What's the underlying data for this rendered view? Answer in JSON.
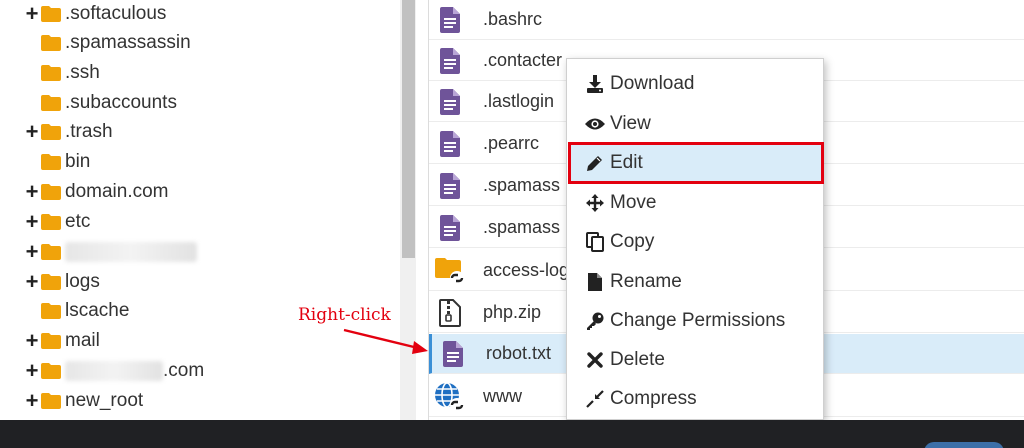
{
  "tree": {
    "items": [
      {
        "toggle": "+",
        "label": ".softaculous",
        "blurred": false
      },
      {
        "toggle": "",
        "label": ".spamassassin",
        "blurred": false
      },
      {
        "toggle": "",
        "label": ".ssh",
        "blurred": false
      },
      {
        "toggle": "",
        "label": ".subaccounts",
        "blurred": false
      },
      {
        "toggle": "+",
        "label": ".trash",
        "blurred": false
      },
      {
        "toggle": "",
        "label": "bin",
        "blurred": false
      },
      {
        "toggle": "+",
        "label": "domain.com",
        "blurred": false
      },
      {
        "toggle": "+",
        "label": "etc",
        "blurred": false
      },
      {
        "toggle": "+",
        "label": "",
        "blurred": true
      },
      {
        "toggle": "+",
        "label": "logs",
        "blurred": false
      },
      {
        "toggle": "",
        "label": "lscache",
        "blurred": false
      },
      {
        "toggle": "+",
        "label": "mail",
        "blurred": false
      },
      {
        "toggle": "+",
        "label": ".com",
        "blurred": true
      },
      {
        "toggle": "+",
        "label": "new_root",
        "blurred": false
      }
    ]
  },
  "files": {
    "items": [
      {
        "name": ".bashrc",
        "icon": "text-file-icon"
      },
      {
        "name": ".contacter",
        "icon": "text-file-icon"
      },
      {
        "name": ".lastlogin",
        "icon": "text-file-icon"
      },
      {
        "name": ".pearrc",
        "icon": "text-file-icon"
      },
      {
        "name": ".spamass",
        "icon": "text-file-icon"
      },
      {
        "name": ".spamass",
        "icon": "text-file-icon"
      },
      {
        "name": "access-log",
        "icon": "folder-link-icon"
      },
      {
        "name": "php.zip",
        "icon": "zip-file-icon"
      },
      {
        "name": "robot.txt",
        "icon": "text-file-icon",
        "selected": true
      },
      {
        "name": "www",
        "icon": "globe-link-icon"
      }
    ]
  },
  "context_menu": {
    "items": [
      {
        "label": "Download",
        "icon": "download-icon"
      },
      {
        "label": "View",
        "icon": "eye-icon"
      },
      {
        "label": "Edit",
        "icon": "pencil-icon",
        "highlighted": true
      },
      {
        "label": "Move",
        "icon": "move-arrows-icon"
      },
      {
        "label": "Copy",
        "icon": "copy-icon"
      },
      {
        "label": "Rename",
        "icon": "file-icon"
      },
      {
        "label": "Change Permissions",
        "icon": "key-icon"
      },
      {
        "label": "Delete",
        "icon": "x-icon"
      },
      {
        "label": "Compress",
        "icon": "compress-icon"
      }
    ]
  },
  "annotation": {
    "text": "Right-click"
  },
  "colors": {
    "folder": "#f0a30a",
    "text_file": "#6f5499",
    "selection": "#d9ecf9",
    "annotation_red": "#e3000f"
  }
}
